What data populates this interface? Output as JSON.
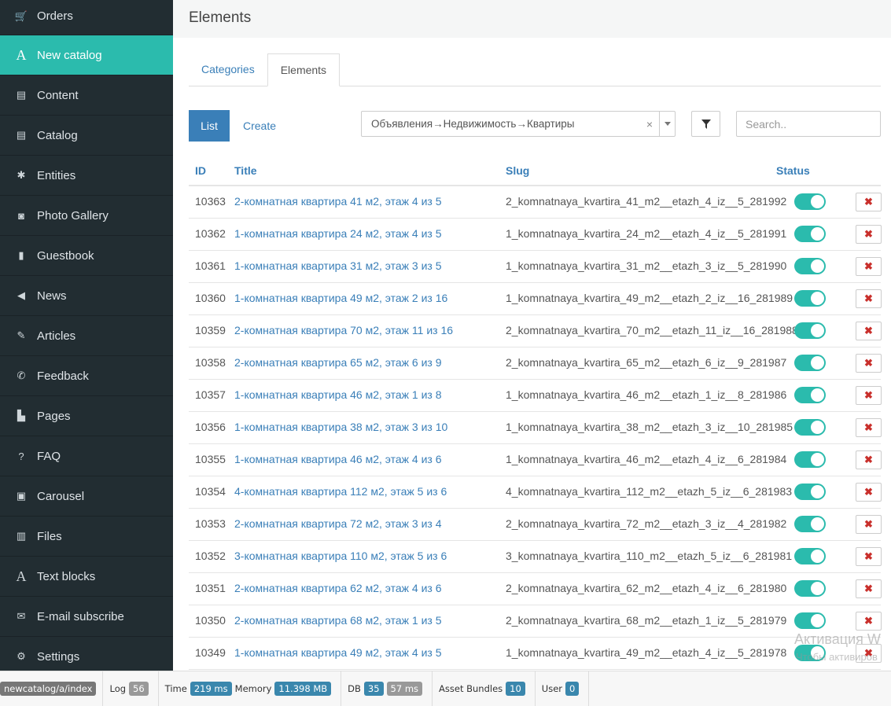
{
  "sidebar": {
    "items": [
      {
        "label": "Orders",
        "icon": "cart-icon",
        "glyph": "🛒"
      },
      {
        "label": "New catalog",
        "icon": "letter-a-icon",
        "glyph": "A",
        "active": true
      },
      {
        "label": "Content",
        "icon": "list-icon",
        "glyph": "▤"
      },
      {
        "label": "Catalog",
        "icon": "list-icon",
        "glyph": "▤"
      },
      {
        "label": "Entities",
        "icon": "asterisk-icon",
        "glyph": "✱"
      },
      {
        "label": "Photo Gallery",
        "icon": "camera-icon",
        "glyph": "◙"
      },
      {
        "label": "Guestbook",
        "icon": "book-icon",
        "glyph": "▮"
      },
      {
        "label": "News",
        "icon": "bullhorn-icon",
        "glyph": "◀"
      },
      {
        "label": "Articles",
        "icon": "pencil-icon",
        "glyph": "✎"
      },
      {
        "label": "Feedback",
        "icon": "phone-icon",
        "glyph": "✆"
      },
      {
        "label": "Pages",
        "icon": "file-icon",
        "glyph": "▙"
      },
      {
        "label": "FAQ",
        "icon": "question-icon",
        "glyph": "?"
      },
      {
        "label": "Carousel",
        "icon": "picture-icon",
        "glyph": "▣"
      },
      {
        "label": "Files",
        "icon": "floppy-icon",
        "glyph": "▥"
      },
      {
        "label": "Text blocks",
        "icon": "letter-a-icon",
        "glyph": "A"
      },
      {
        "label": "E-mail subscribe",
        "icon": "envelope-icon",
        "glyph": "✉"
      },
      {
        "label": "Settings",
        "icon": "cog-icon",
        "glyph": "⚙"
      }
    ]
  },
  "page": {
    "title": "Elements"
  },
  "tabs": [
    {
      "label": "Categories",
      "active": false
    },
    {
      "label": "Elements",
      "active": true
    }
  ],
  "toolbar": {
    "list_label": "List",
    "create_label": "Create",
    "category_selected": "Объявления→Недвижимость→Квартиры",
    "clear_glyph": "×",
    "search_placeholder": "Search.."
  },
  "table": {
    "columns": {
      "id": "ID",
      "title": "Title",
      "slug": "Slug",
      "status": "Status"
    },
    "rows": [
      {
        "id": "10363",
        "title": "2-комнатная квартира 41 м2, этаж 4 из 5",
        "slug": "2_komnatnaya_kvartira_41_m2__etazh_4_iz__5_281992",
        "status": true
      },
      {
        "id": "10362",
        "title": "1-комнатная квартира 24 м2, этаж 4 из 5",
        "slug": "1_komnatnaya_kvartira_24_m2__etazh_4_iz__5_281991",
        "status": true
      },
      {
        "id": "10361",
        "title": "1-комнатная квартира 31 м2, этаж 3 из 5",
        "slug": "1_komnatnaya_kvartira_31_m2__etazh_3_iz__5_281990",
        "status": true
      },
      {
        "id": "10360",
        "title": "1-комнатная квартира 49 м2, этаж 2 из 16",
        "slug": "1_komnatnaya_kvartira_49_m2__etazh_2_iz__16_281989",
        "status": true
      },
      {
        "id": "10359",
        "title": "2-комнатная квартира 70 м2, этаж 11 из 16",
        "slug": "2_komnatnaya_kvartira_70_m2__etazh_11_iz__16_281988",
        "status": true
      },
      {
        "id": "10358",
        "title": "2-комнатная квартира 65 м2, этаж 6 из 9",
        "slug": "2_komnatnaya_kvartira_65_m2__etazh_6_iz__9_281987",
        "status": true
      },
      {
        "id": "10357",
        "title": "1-комнатная квартира 46 м2, этаж 1 из 8",
        "slug": "1_komnatnaya_kvartira_46_m2__etazh_1_iz__8_281986",
        "status": true
      },
      {
        "id": "10356",
        "title": "1-комнатная квартира 38 м2, этаж 3 из 10",
        "slug": "1_komnatnaya_kvartira_38_m2__etazh_3_iz__10_281985",
        "status": true
      },
      {
        "id": "10355",
        "title": "1-комнатная квартира 46 м2, этаж 4 из 6",
        "slug": "1_komnatnaya_kvartira_46_m2__etazh_4_iz__6_281984",
        "status": true
      },
      {
        "id": "10354",
        "title": "4-комнатная квартира 112 м2, этаж 5 из 6",
        "slug": "4_komnatnaya_kvartira_112_m2__etazh_5_iz__6_281983",
        "status": true
      },
      {
        "id": "10353",
        "title": "2-комнатная квартира 72 м2, этаж 3 из 4",
        "slug": "2_komnatnaya_kvartira_72_m2__etazh_3_iz__4_281982",
        "status": true
      },
      {
        "id": "10352",
        "title": "3-комнатная квартира 110 м2, этаж 5 из 6",
        "slug": "3_komnatnaya_kvartira_110_m2__etazh_5_iz__6_281981",
        "status": true
      },
      {
        "id": "10351",
        "title": "2-комнатная квартира 62 м2, этаж 4 из 6",
        "slug": "2_komnatnaya_kvartira_62_m2__etazh_4_iz__6_281980",
        "status": true
      },
      {
        "id": "10350",
        "title": "2-комнатная квартира 68 м2, этаж 1 из 5",
        "slug": "2_komnatnaya_kvartira_68_m2__etazh_1_iz__5_281979",
        "status": true
      },
      {
        "id": "10349",
        "title": "1-комнатная квартира 49 м2, этаж 4 из 5",
        "slug": "1_komnatnaya_kvartira_49_m2__etazh_4_iz__5_281978",
        "status": true
      }
    ],
    "delete_glyph": "✖"
  },
  "watermark": {
    "line1": "Активация W",
    "line2": "Чтобы активиров"
  },
  "debugbar": {
    "route": "newcatalog/a/index",
    "log_label": "Log",
    "log_count": "56",
    "time_label": "Time",
    "time_value": "219 ms",
    "memory_label": "Memory",
    "memory_value": "11.398 MB",
    "db_label": "DB",
    "db_count": "35",
    "db_time": "57 ms",
    "assets_label": "Asset Bundles",
    "assets_count": "10",
    "user_label": "User",
    "user_value": "0"
  },
  "colors": {
    "accent": "#2bbbad",
    "sidebar_bg": "#222d32",
    "link": "#3a7fb8",
    "danger": "#c9302c"
  }
}
